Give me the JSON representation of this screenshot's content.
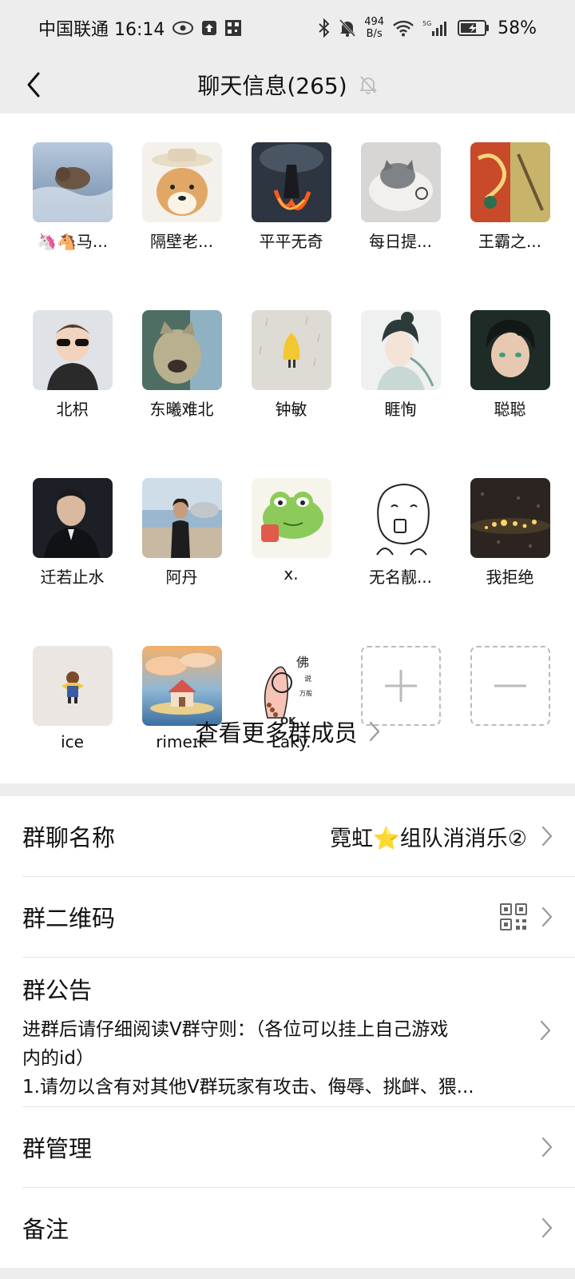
{
  "status_bar": {
    "carrier_time": "中国联通 16:14",
    "net_speed_value": "494",
    "net_speed_unit": "B/s",
    "battery": "58%"
  },
  "nav": {
    "title": "聊天信息(265)"
  },
  "members": [
    {
      "name": "🦄🐴马..."
    },
    {
      "name": "隔壁老..."
    },
    {
      "name": "平平无奇"
    },
    {
      "name": "每日提..."
    },
    {
      "name": "王霸之..."
    },
    {
      "name": "北枳"
    },
    {
      "name": "东曦难北"
    },
    {
      "name": "钟敏"
    },
    {
      "name": "睚恂"
    },
    {
      "name": "聪聪"
    },
    {
      "name": "迁若止水"
    },
    {
      "name": "阿丹"
    },
    {
      "name": "x."
    },
    {
      "name": "无名靓..."
    },
    {
      "name": "我拒绝"
    },
    {
      "name": "ice"
    },
    {
      "name": "rimeɪk"
    },
    {
      "name": "Laky."
    }
  ],
  "view_more": "查看更多群成员",
  "settings": {
    "group_name_label": "群聊名称",
    "group_name_value": "霓虹⭐组队消消乐②",
    "qr_label": "群二维码",
    "notice_label": "群公告",
    "notice_line1": "进群后请仔细阅读V群守则：（各位可以挂上自己游戏",
    "notice_line2": "内的id）",
    "notice_line3": "1.请勿以含有对其他V群玩家有攻击、侮辱、挑衅、猥...",
    "manage_label": "群管理",
    "remark_label": "备注"
  }
}
